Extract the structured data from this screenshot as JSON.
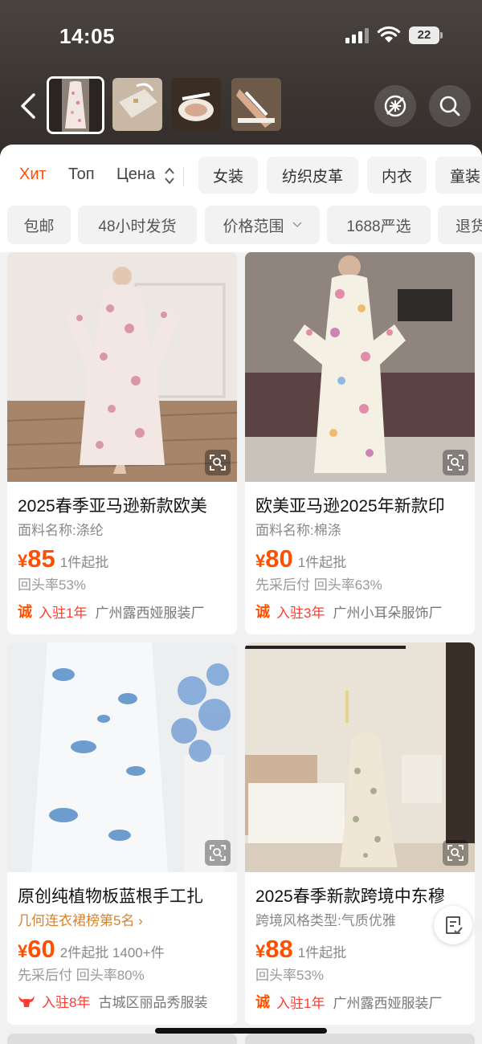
{
  "status_bar": {
    "time": "14:05",
    "battery": "22"
  },
  "header": {
    "thumbnails": [
      "product-photo-1",
      "product-photo-2",
      "product-photo-3",
      "product-photo-4"
    ],
    "icons": [
      "back-icon",
      "no-image-icon",
      "search-icon"
    ]
  },
  "sort": {
    "items": [
      "Хит",
      "Топ",
      "Цена"
    ],
    "active": "Хит",
    "categories": [
      "女装",
      "纺织皮革",
      "内衣",
      "童装"
    ]
  },
  "filters": [
    "包邮",
    "48小时发货",
    "价格范围",
    "1688严选",
    "退货"
  ],
  "products": [
    {
      "title": "2025春季亚马逊新款欧美",
      "subtitle": "面料名称:涤纶",
      "currency": "¥",
      "price": "85",
      "price_note": "1件起批",
      "tags": "回头率53%",
      "badge": "诚",
      "years": "入驻1年",
      "shop": "广州露西娅服装厂"
    },
    {
      "title": "欧美亚马逊2025年新款印",
      "subtitle": "面料名称:棉涤",
      "currency": "¥",
      "price": "80",
      "price_note": "1件起批",
      "tags": "先采后付  回头率63%",
      "badge": "诚",
      "years": "入驻3年",
      "shop": "广州小耳朵服饰厂"
    },
    {
      "title": "原创纯植物板蓝根手工扎",
      "subtitle": "几何连衣裙榜第5名 ›",
      "currency": "¥",
      "price": "60",
      "price_note": "2件起批  1400+件",
      "tags": "先采后付  回头率80%",
      "badge": "牛",
      "years": "入驻8年",
      "shop": "古城区丽品秀服装"
    },
    {
      "title": "2025春季新款跨境中东穆",
      "subtitle": "跨境风格类型:气质优雅",
      "currency": "¥",
      "price": "88",
      "price_note": "1件起批",
      "tags": "回头率53%",
      "badge": "诚",
      "years": "入驻1年",
      "shop": "广州露西娅服装厂"
    }
  ],
  "colors": {
    "accent": "#ff5000",
    "rank": "#d9822b"
  }
}
